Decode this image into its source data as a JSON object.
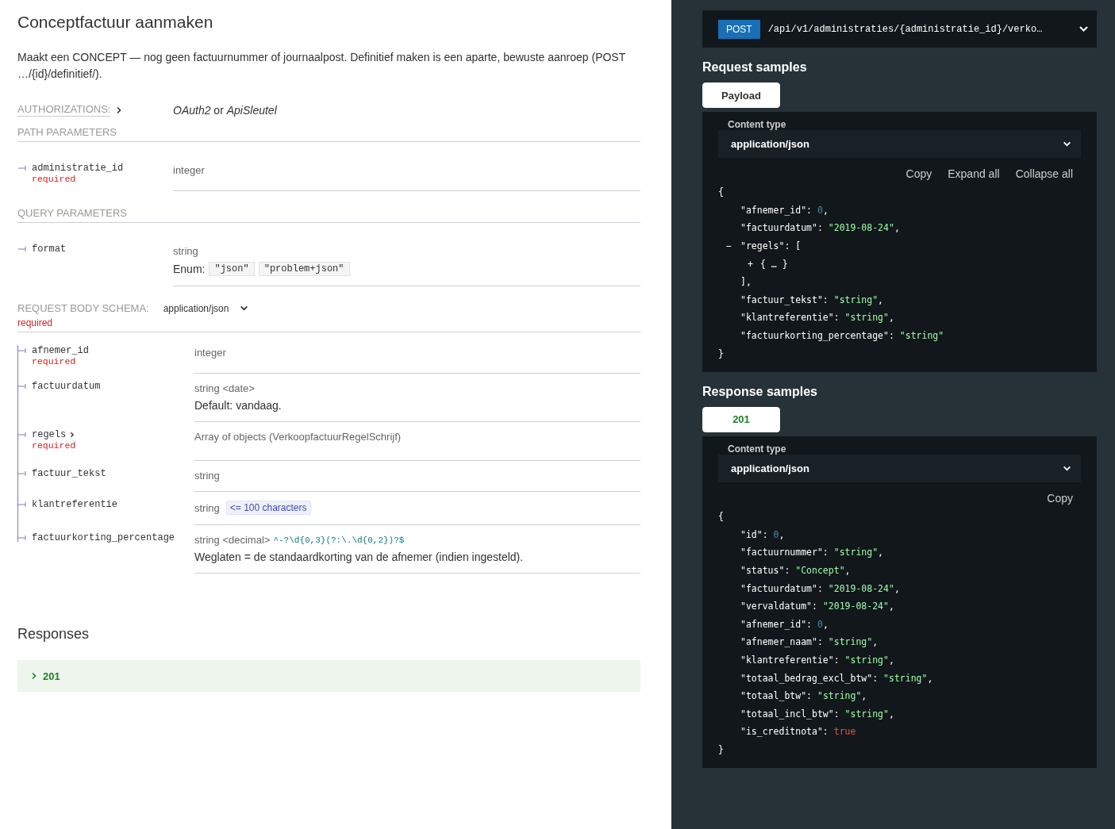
{
  "title": "Conceptfactuur aanmaken",
  "description": "Maakt een CONCEPT — nog geen factuurnummer of journaalpost. Definitief maken is een aparte, bewuste aanroep (POST …/{id}/definitief/).",
  "authorizations": {
    "label": "AUTHORIZATIONS:",
    "value": "*OAuth2* or *ApiSleutel*"
  },
  "sections": [
    {
      "kind": "path",
      "title": "PATH PARAMETERS",
      "params": [
        {
          "name": "administratie_id",
          "required": "required",
          "type": "integer"
        }
      ]
    },
    {
      "kind": "query",
      "title": "QUERY PARAMETERS",
      "params": [
        {
          "name": "format",
          "type": "string",
          "enum_label": "Enum:",
          "enum": [
            "\"json\"",
            "\"problem+json\""
          ]
        }
      ]
    },
    {
      "kind": "body",
      "title": "REQUEST BODY SCHEMA:",
      "media": "application/json",
      "required": "required",
      "params": [
        {
          "name": "afnemer_id",
          "required": "required",
          "type": "integer"
        },
        {
          "name": "factuurdatum",
          "type": "string <date>",
          "note": "Default: vandaag."
        },
        {
          "name": "regels",
          "required": "required",
          "expandable": true,
          "type": "Array of objects (VerkoopfactuurRegelSchrijf)"
        },
        {
          "name": "factuur_tekst",
          "type": "string"
        },
        {
          "name": "klantreferentie",
          "type": "string",
          "constraint": "<= 100 characters"
        },
        {
          "name": "factuurkorting_percentage",
          "type": "string <decimal>",
          "pattern": "^-?\\d{0,3}(?:\\.\\d{0,2})?$",
          "note": "Weglaten = de standaardkorting van de afnemer (indien ingesteld)."
        }
      ]
    }
  ],
  "responses": {
    "title": "Responses",
    "items": [
      {
        "code": "201",
        "expanded": false
      }
    ]
  },
  "endpoint": {
    "method": "POST",
    "path": "/api/v1/administraties/{administratie_id}/verko…"
  },
  "samples": [
    {
      "title": "Request samples",
      "tabs": [
        {
          "label": "Payload",
          "selected": true,
          "kind": "payload"
        }
      ],
      "content_type_label": "Content type",
      "content_type": "application/json",
      "actions": [
        "Copy",
        "Expand all",
        "Collapse all"
      ],
      "lines": [
        {
          "kind": "open",
          "text": "{"
        },
        {
          "kind": "pair",
          "key": "\"afnemer_id\":",
          "value": {
            "kind": "number",
            "text": "0"
          },
          "tail": ","
        },
        {
          "kind": "pair",
          "key": "\"factuurdatum\":",
          "value": {
            "kind": "string",
            "text": "\"2019-08-24\""
          },
          "tail": ","
        },
        {
          "kind": "array_open",
          "toggle": "−",
          "key": "\"regels\":",
          "bracket": "["
        },
        {
          "kind": "collapsed",
          "toggle": "+",
          "text": "{ … }"
        },
        {
          "kind": "array_close",
          "text": "],"
        },
        {
          "kind": "pair",
          "key": "\"factuur_tekst\":",
          "value": {
            "kind": "string",
            "text": "\"string\""
          },
          "tail": ","
        },
        {
          "kind": "pair",
          "key": "\"klantreferentie\":",
          "value": {
            "kind": "string",
            "text": "\"string\""
          },
          "tail": ","
        },
        {
          "kind": "pair",
          "key": "\"factuurkorting_percentage\":",
          "value": {
            "kind": "string",
            "text": "\"string\""
          }
        },
        {
          "kind": "close",
          "text": "}"
        }
      ]
    },
    {
      "title": "Response samples",
      "tabs": [
        {
          "label": "201",
          "selected": true,
          "kind": "status"
        }
      ],
      "content_type_label": "Content type",
      "content_type": "application/json",
      "actions": [
        "Copy"
      ],
      "lines": [
        {
          "kind": "open",
          "text": "{"
        },
        {
          "kind": "pair",
          "key": "\"id\":",
          "value": {
            "kind": "number",
            "text": "0"
          },
          "tail": ","
        },
        {
          "kind": "pair",
          "key": "\"factuurnummer\":",
          "value": {
            "kind": "string",
            "text": "\"string\""
          },
          "tail": ","
        },
        {
          "kind": "pair",
          "key": "\"status\":",
          "value": {
            "kind": "string",
            "text": "\"Concept\""
          },
          "tail": ","
        },
        {
          "kind": "pair",
          "key": "\"factuurdatum\":",
          "value": {
            "kind": "string",
            "text": "\"2019-08-24\""
          },
          "tail": ","
        },
        {
          "kind": "pair",
          "key": "\"vervaldatum\":",
          "value": {
            "kind": "string",
            "text": "\"2019-08-24\""
          },
          "tail": ","
        },
        {
          "kind": "pair",
          "key": "\"afnemer_id\":",
          "value": {
            "kind": "number",
            "text": "0"
          },
          "tail": ","
        },
        {
          "kind": "pair",
          "key": "\"afnemer_naam\":",
          "value": {
            "kind": "string",
            "text": "\"string\""
          },
          "tail": ","
        },
        {
          "kind": "pair",
          "key": "\"klantreferentie\":",
          "value": {
            "kind": "string",
            "text": "\"string\""
          },
          "tail": ","
        },
        {
          "kind": "pair",
          "key": "\"totaal_bedrag_excl_btw\":",
          "value": {
            "kind": "string",
            "text": "\"string\""
          },
          "tail": ","
        },
        {
          "kind": "pair",
          "key": "\"totaal_btw\":",
          "value": {
            "kind": "string",
            "text": "\"string\""
          },
          "tail": ","
        },
        {
          "kind": "pair",
          "key": "\"totaal_incl_btw\":",
          "value": {
            "kind": "string",
            "text": "\"string\""
          },
          "tail": ","
        },
        {
          "kind": "pair",
          "key": "\"is_creditnota\":",
          "value": {
            "kind": "boolean",
            "text": "true"
          }
        },
        {
          "kind": "close",
          "text": "}"
        }
      ]
    }
  ]
}
